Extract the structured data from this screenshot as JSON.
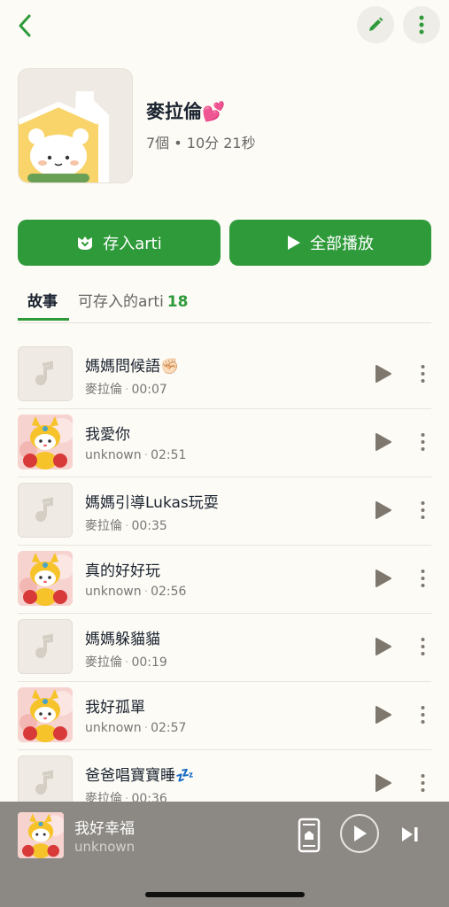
{
  "header": {
    "back_icon": "chevron-left-icon",
    "edit_icon": "pencil-icon",
    "more_icon": "vertical-dots-icon"
  },
  "playlist": {
    "title": "麥拉倫💕",
    "meta": "7個 • 10分 21秒"
  },
  "actions": {
    "save_label": "存入arti",
    "play_all_label": "全部播放"
  },
  "tabs": {
    "story": "故事",
    "arti": "可存入的arti",
    "arti_count": "18"
  },
  "tracks": [
    {
      "title": "媽媽問候語✊🏻",
      "author": "麥拉倫",
      "duration": "00:07",
      "thumb": "placeholder"
    },
    {
      "title": "我愛你",
      "author": "unknown",
      "duration": "02:51",
      "thumb": "character"
    },
    {
      "title": "媽媽引導Lukas玩耍",
      "author": "麥拉倫",
      "duration": "00:35",
      "thumb": "placeholder"
    },
    {
      "title": "真的好好玩",
      "author": "unknown",
      "duration": "02:56",
      "thumb": "character"
    },
    {
      "title": "媽媽躲貓貓",
      "author": "麥拉倫",
      "duration": "00:19",
      "thumb": "placeholder"
    },
    {
      "title": "我好孤單",
      "author": "unknown",
      "duration": "02:57",
      "thumb": "character"
    },
    {
      "title": "爸爸唱寶寶睡💤",
      "author": "麥拉倫",
      "duration": "00:36",
      "thumb": "placeholder"
    }
  ],
  "player": {
    "title": "我好幸福",
    "subtitle": "unknown"
  },
  "colors": {
    "accent": "#2e9a3a",
    "background": "#fdfbf5",
    "player_bg": "#8c8984"
  }
}
